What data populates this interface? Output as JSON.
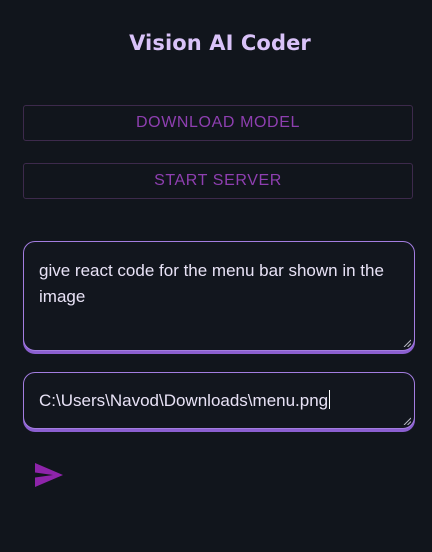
{
  "app": {
    "title": "Vision AI Coder"
  },
  "buttons": {
    "download_model": "DOWNLOAD MODEL",
    "start_server": "START SERVER"
  },
  "prompt": {
    "value": "give react code for the menu bar shown in the image"
  },
  "image_path": {
    "value": "C:\\Users\\Navod\\Downloads\\menu.png"
  },
  "icons": {
    "send": "send-icon",
    "resize": "resize-grip-icon"
  },
  "colors": {
    "background": "#11151c",
    "title": "#d9c2f8",
    "button_text": "#8e3fb0",
    "button_border": "#3d2a4c",
    "field_border": "#a37de0",
    "send_icon": "#8e24aa"
  }
}
